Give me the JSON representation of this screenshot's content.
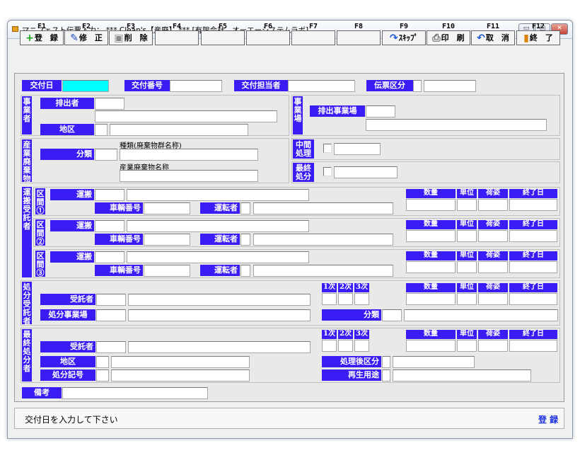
{
  "window": {
    "title": "マニフェスト伝票入力： *** Clean's【産廃】 *** [有限会社　オーエーシステムラボ]",
    "min": "▭",
    "max": "▢",
    "close": "✕"
  },
  "fkeys": [
    {
      "key": "F1",
      "label": "登　録",
      "icon": "plus-icon"
    },
    {
      "key": "F2",
      "label": "修　正",
      "icon": "pencil-icon"
    },
    {
      "key": "F3",
      "label": "削　除",
      "icon": "delete-icon"
    },
    {
      "key": "F4",
      "label": ""
    },
    {
      "key": "F5",
      "label": ""
    },
    {
      "key": "F6",
      "label": ""
    },
    {
      "key": "F7",
      "label": ""
    },
    {
      "key": "F8",
      "label": ""
    },
    {
      "key": "F9",
      "label": "ｽｷｯﾌﾟ",
      "icon": "skip-icon"
    },
    {
      "key": "F10",
      "label": "印　刷",
      "icon": "print-icon"
    },
    {
      "key": "F11",
      "label": "取　消",
      "icon": "undo-icon"
    },
    {
      "key": "F12",
      "label": "終　了",
      "icon": "exit-icon"
    }
  ],
  "header": {
    "date": "交付日",
    "number": "交付番号",
    "person": "交付担当者",
    "slip": "伝票区分"
  },
  "jigyo": {
    "side": "事業者",
    "hai": "排出者",
    "area": "地区",
    "side2": "事業場",
    "place": "排出事業場"
  },
  "sanpai": {
    "side": "産業廃棄物",
    "bunrui": "分類",
    "kind": "種類(廃棄物群名称)",
    "name": "産業廃棄物名称",
    "chukan": "中間処理",
    "saishu": "最終処分"
  },
  "unpan": {
    "side": "運搬受託者",
    "sections": [
      {
        "tag": "区間①",
        "carrier": "運搬",
        "vehicle": "車輌番号",
        "driver": "運転者"
      },
      {
        "tag": "区間②",
        "carrier": "運搬",
        "vehicle": "車輌番号",
        "driver": "運転者"
      },
      {
        "tag": "区間③",
        "carrier": "運搬",
        "vehicle": "車輌番号",
        "driver": "運転者"
      }
    ]
  },
  "metrics": {
    "qty": "数量",
    "unit": "単位",
    "pack": "荷姿",
    "end": "終了日"
  },
  "shobun": {
    "side": "処分受託者",
    "jutaku": "受託者",
    "place": "処分事業場",
    "j1": "1次",
    "j2": "2次",
    "j3": "3次",
    "bunrui": "分類"
  },
  "saishu": {
    "side": "最終処分者",
    "jutaku": "受託者",
    "area": "地区",
    "code": "処分記号",
    "kubun": "処理後区分",
    "reuse": "再生用途",
    "j1": "1次",
    "j2": "2次",
    "j3": "3次"
  },
  "biko": "備考",
  "status": {
    "message": "交付日を入力して下さい",
    "mode": "登 録"
  }
}
